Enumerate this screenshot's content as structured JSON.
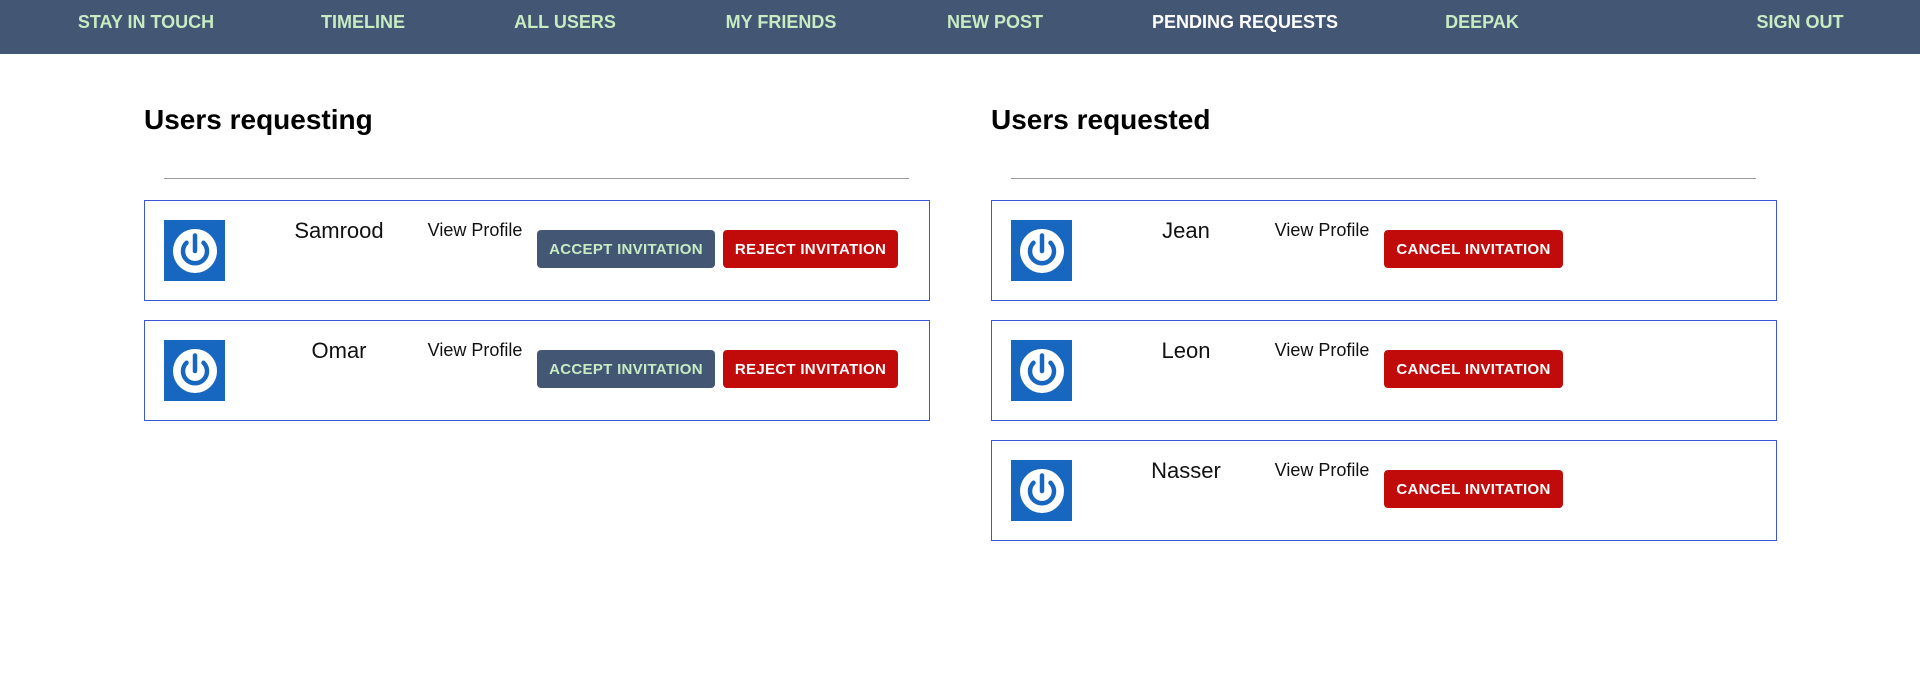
{
  "nav": {
    "items": [
      {
        "label": "STAY IN TOUCH",
        "active": false
      },
      {
        "label": "TIMELINE",
        "active": false
      },
      {
        "label": "ALL USERS",
        "active": false
      },
      {
        "label": "MY FRIENDS",
        "active": false
      },
      {
        "label": "NEW POST",
        "active": false
      },
      {
        "label": "PENDING REQUESTS",
        "active": true
      },
      {
        "label": "DEEPAK",
        "active": false
      },
      {
        "label": "SIGN OUT",
        "active": false
      }
    ]
  },
  "requesting": {
    "title": "Users requesting",
    "users": [
      {
        "name": "Samrood",
        "view_profile": "View Profile",
        "accept_label": "ACCEPT INVITATION",
        "reject_label": "REJECT INVITATION"
      },
      {
        "name": "Omar",
        "view_profile": "View Profile",
        "accept_label": "ACCEPT INVITATION",
        "reject_label": "REJECT INVITATION"
      }
    ]
  },
  "requested": {
    "title": "Users requested",
    "users": [
      {
        "name": "Jean",
        "view_profile": "View Profile",
        "cancel_label": "CANCEL INVITATION"
      },
      {
        "name": "Leon",
        "view_profile": "View Profile",
        "cancel_label": "CANCEL INVITATION"
      },
      {
        "name": "Nasser",
        "view_profile": "View Profile",
        "cancel_label": "CANCEL INVITATION"
      }
    ]
  },
  "avatar_icon": "power-icon",
  "colors": {
    "navbar": "#435775",
    "nav_link": "#c8ebc3",
    "nav_link_active": "#ffffff",
    "card_border": "#3c56d6",
    "avatar_bg": "#1766c0",
    "accept_bg": "#435775",
    "reject_bg": "#c10a0a"
  }
}
